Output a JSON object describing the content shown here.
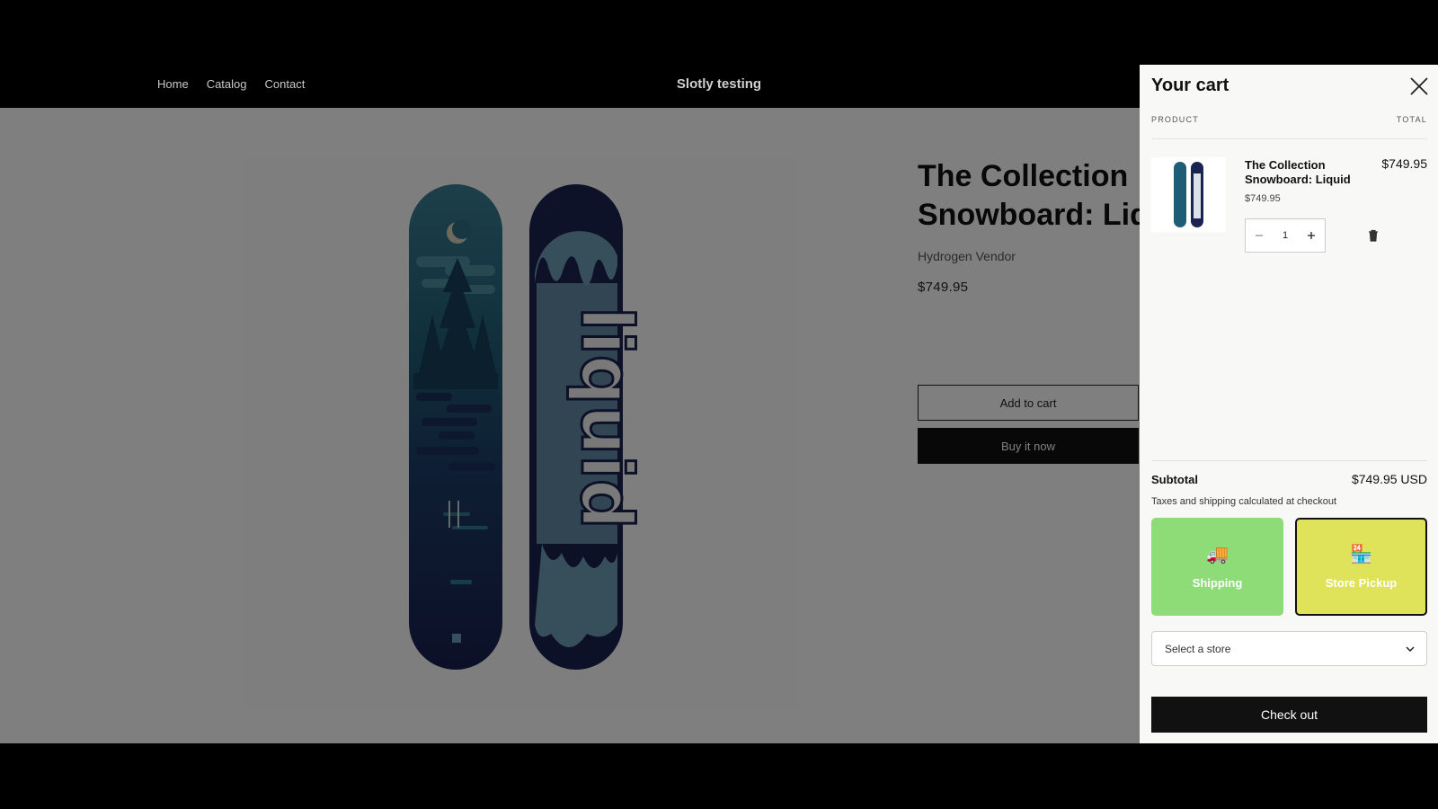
{
  "site": {
    "nav": [
      "Home",
      "Catalog",
      "Contact"
    ],
    "title": "Slotly testing"
  },
  "product": {
    "title_line1": "The Collection",
    "title_line2": "Snowboard: Liquid",
    "vendor": "Hydrogen Vendor",
    "price": "$749.95",
    "add_to_cart_label": "Add to cart",
    "buy_now_label": "Buy it now",
    "board_logo_text": "liquid"
  },
  "cart": {
    "title": "Your cart",
    "col_product": "PRODUCT",
    "col_total": "TOTAL",
    "item": {
      "name": "The Collection Snowboard: Liquid",
      "unit_price": "$749.95",
      "total": "$749.95",
      "quantity": "1"
    },
    "subtotal_label": "Subtotal",
    "subtotal_value": "$749.95 USD",
    "tax_note": "Taxes and shipping calculated at checkout",
    "methods": [
      {
        "label": "Shipping",
        "icon": "delivery-truck-icon",
        "glyph": "🚚",
        "color": "#8edc78"
      },
      {
        "label": "Store Pickup",
        "icon": "store-icon",
        "glyph": "🏪",
        "color": "#dfe35a",
        "selected": true
      }
    ],
    "store_select_placeholder": "Select a store",
    "checkout_label": "Check out"
  }
}
